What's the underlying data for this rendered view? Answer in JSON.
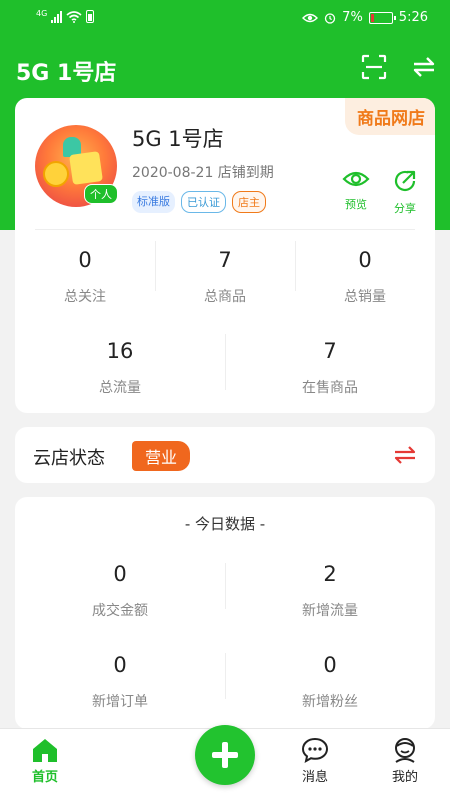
{
  "status_bar": {
    "network": "4G",
    "battery_pct": "7%",
    "time": "5:26"
  },
  "header": {
    "title": "5G 1号店"
  },
  "shop": {
    "ribbon": "商品网店",
    "avatar_badge": "个人",
    "name": "5G 1号店",
    "expire": "2020-08-21 店铺到期",
    "tags": [
      "标准版",
      "已认证",
      "店主"
    ],
    "actions": {
      "preview": "预览",
      "share": "分享"
    },
    "stats_row1": [
      {
        "value": "0",
        "label": "总关注"
      },
      {
        "value": "7",
        "label": "总商品"
      },
      {
        "value": "0",
        "label": "总销量"
      }
    ],
    "stats_row2": [
      {
        "value": "16",
        "label": "总流量"
      },
      {
        "value": "7",
        "label": "在售商品"
      }
    ]
  },
  "cloud_status": {
    "label": "云店状态",
    "badge": "营业"
  },
  "today": {
    "title": "- 今日数据 -",
    "stats": [
      {
        "value": "0",
        "label": "成交金额"
      },
      {
        "value": "2",
        "label": "新增流量"
      },
      {
        "value": "0",
        "label": "新增订单"
      },
      {
        "value": "0",
        "label": "新增粉丝"
      }
    ]
  },
  "tabbar": {
    "home": "首页",
    "messages": "消息",
    "mine": "我的"
  },
  "colors": {
    "brand": "#1fbf2b",
    "accent_orange": "#f0671e",
    "switch_red": "#e53935"
  }
}
